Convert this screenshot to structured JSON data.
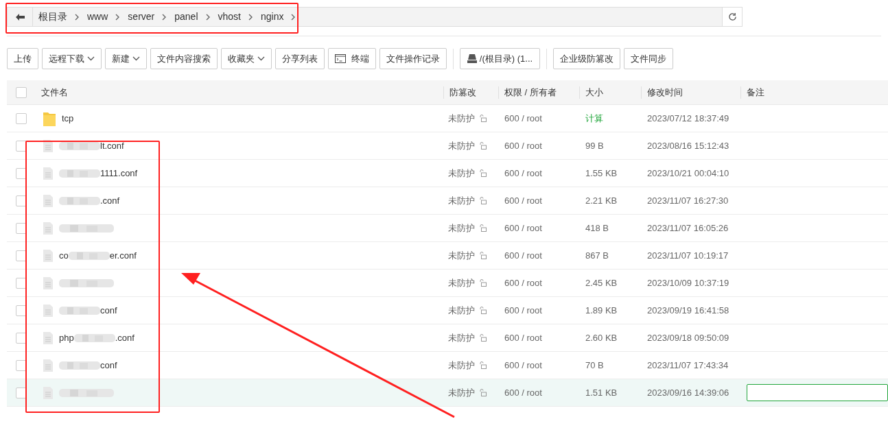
{
  "breadcrumb": [
    "根目录",
    "www",
    "server",
    "panel",
    "vhost",
    "nginx"
  ],
  "toolbar": [
    {
      "label": "上传",
      "kind": "plain"
    },
    {
      "label": "远程下载",
      "kind": "dropdown"
    },
    {
      "label": "新建",
      "kind": "dropdown"
    },
    {
      "label": "文件内容搜索",
      "kind": "plain"
    },
    {
      "label": "收藏夹",
      "kind": "dropdown"
    },
    {
      "label": "分享列表",
      "kind": "plain"
    },
    {
      "label": "终端",
      "kind": "terminal"
    },
    {
      "label": "文件操作记录",
      "kind": "plain"
    },
    {
      "label": "/(根目录) (1...",
      "kind": "disk"
    },
    {
      "label": "企业级防篡改",
      "kind": "plain"
    },
    {
      "label": "文件同步",
      "kind": "plain"
    }
  ],
  "table": {
    "all_checked": false,
    "columns": [
      "文件名",
      "防篡改",
      "权限 / 所有者",
      "大小",
      "修改时间",
      "备注"
    ],
    "rows": [
      {
        "kind": "folder",
        "name": "tcp",
        "protect": "未防护",
        "perm": "600 / root",
        "size": "计算",
        "size_action": true,
        "mtime": "2023/07/12 18:37:49",
        "checked": false,
        "selected": false
      },
      {
        "kind": "file",
        "name_tail": "lt.conf",
        "protect": "未防护",
        "perm": "600 / root",
        "size": "99 B",
        "size_action": false,
        "mtime": "2023/08/16 15:12:43",
        "checked": false,
        "selected": false
      },
      {
        "kind": "file",
        "name_tail": "1111.conf",
        "protect": "未防护",
        "perm": "600 / root",
        "size": "1.55 KB",
        "size_action": false,
        "mtime": "2023/10/21 00:04:10",
        "checked": false,
        "selected": false
      },
      {
        "kind": "file",
        "name_tail": ".conf",
        "protect": "未防护",
        "perm": "600 / root",
        "size": "2.21 KB",
        "size_action": false,
        "mtime": "2023/11/07 16:27:30",
        "checked": false,
        "selected": false
      },
      {
        "kind": "file",
        "protect": "未防护",
        "perm": "600 / root",
        "size": "418 B",
        "size_action": false,
        "mtime": "2023/11/07 16:05:26",
        "checked": false,
        "selected": false
      },
      {
        "kind": "file",
        "name_head": "co",
        "name_tail": "er.conf",
        "protect": "未防护",
        "perm": "600 / root",
        "size": "867 B",
        "size_action": false,
        "mtime": "2023/11/07 10:19:17",
        "checked": false,
        "selected": false
      },
      {
        "kind": "file",
        "protect": "未防护",
        "perm": "600 / root",
        "size": "2.45 KB",
        "size_action": false,
        "mtime": "2023/10/09 10:37:19",
        "checked": false,
        "selected": false
      },
      {
        "kind": "file",
        "name_tail": "conf",
        "protect": "未防护",
        "perm": "600 / root",
        "size": "1.89 KB",
        "size_action": false,
        "mtime": "2023/09/19 16:41:58",
        "checked": false,
        "selected": false
      },
      {
        "kind": "file",
        "name_head": "php",
        "name_tail": ".conf",
        "protect": "未防护",
        "perm": "600 / root",
        "size": "2.60 KB",
        "size_action": false,
        "mtime": "2023/09/18 09:50:09",
        "checked": false,
        "selected": false
      },
      {
        "kind": "file",
        "name_tail": "conf",
        "protect": "未防护",
        "perm": "600 / root",
        "size": "70 B",
        "size_action": false,
        "mtime": "2023/11/07 17:43:34",
        "checked": false,
        "selected": false
      },
      {
        "kind": "file",
        "protect": "未防护",
        "perm": "600 / root",
        "size": "1.51 KB",
        "size_action": false,
        "mtime": "2023/09/16 14:39:06",
        "checked": false,
        "selected": true
      }
    ]
  }
}
